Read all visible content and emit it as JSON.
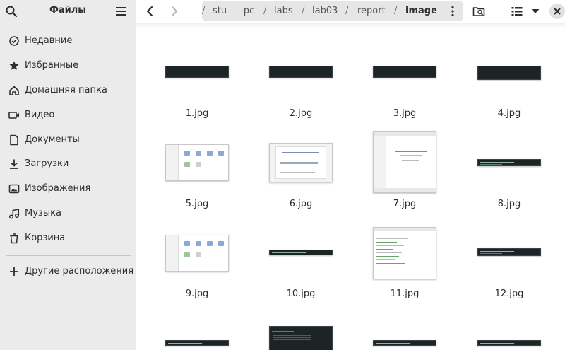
{
  "window": {
    "title": "Файлы"
  },
  "sidebar": {
    "items": [
      {
        "label": "Недавние",
        "icon": "clock-icon"
      },
      {
        "label": "Избранные",
        "icon": "star-icon"
      },
      {
        "label": "Домашняя папка",
        "icon": "home-icon"
      },
      {
        "label": "Видео",
        "icon": "video-icon"
      },
      {
        "label": "Документы",
        "icon": "document-icon"
      },
      {
        "label": "Загрузки",
        "icon": "download-icon"
      },
      {
        "label": "Изображения",
        "icon": "image-icon"
      },
      {
        "label": "Музыка",
        "icon": "music-icon"
      },
      {
        "label": "Корзина",
        "icon": "trash-icon"
      }
    ],
    "other": {
      "label": "Другие расположения",
      "icon": "plus-icon"
    }
  },
  "path": {
    "segments": [
      "stu",
      "-pc",
      "labs",
      "lab03",
      "report",
      "image"
    ],
    "separator": "/"
  },
  "files": [
    {
      "name": "1.jpg",
      "kind": "terminal"
    },
    {
      "name": "2.jpg",
      "kind": "terminal"
    },
    {
      "name": "3.jpg",
      "kind": "terminal"
    },
    {
      "name": "4.jpg",
      "kind": "terminal"
    },
    {
      "name": "5.jpg",
      "kind": "file-manager"
    },
    {
      "name": "6.jpg",
      "kind": "document"
    },
    {
      "name": "7.jpg",
      "kind": "document-tall"
    },
    {
      "name": "8.jpg",
      "kind": "terminal"
    },
    {
      "name": "9.jpg",
      "kind": "file-manager"
    },
    {
      "name": "10.jpg",
      "kind": "terminal"
    },
    {
      "name": "11.jpg",
      "kind": "editor"
    },
    {
      "name": "12.jpg",
      "kind": "terminal"
    },
    {
      "name": "",
      "kind": "terminal"
    },
    {
      "name": "",
      "kind": "terminal-large"
    },
    {
      "name": "",
      "kind": "terminal"
    },
    {
      "name": "",
      "kind": "terminal"
    }
  ],
  "colors": {
    "sidebar_bg": "#ebebeb",
    "pathbar_bg": "#e6e6e6",
    "terminal_bg": "#1d2426"
  }
}
